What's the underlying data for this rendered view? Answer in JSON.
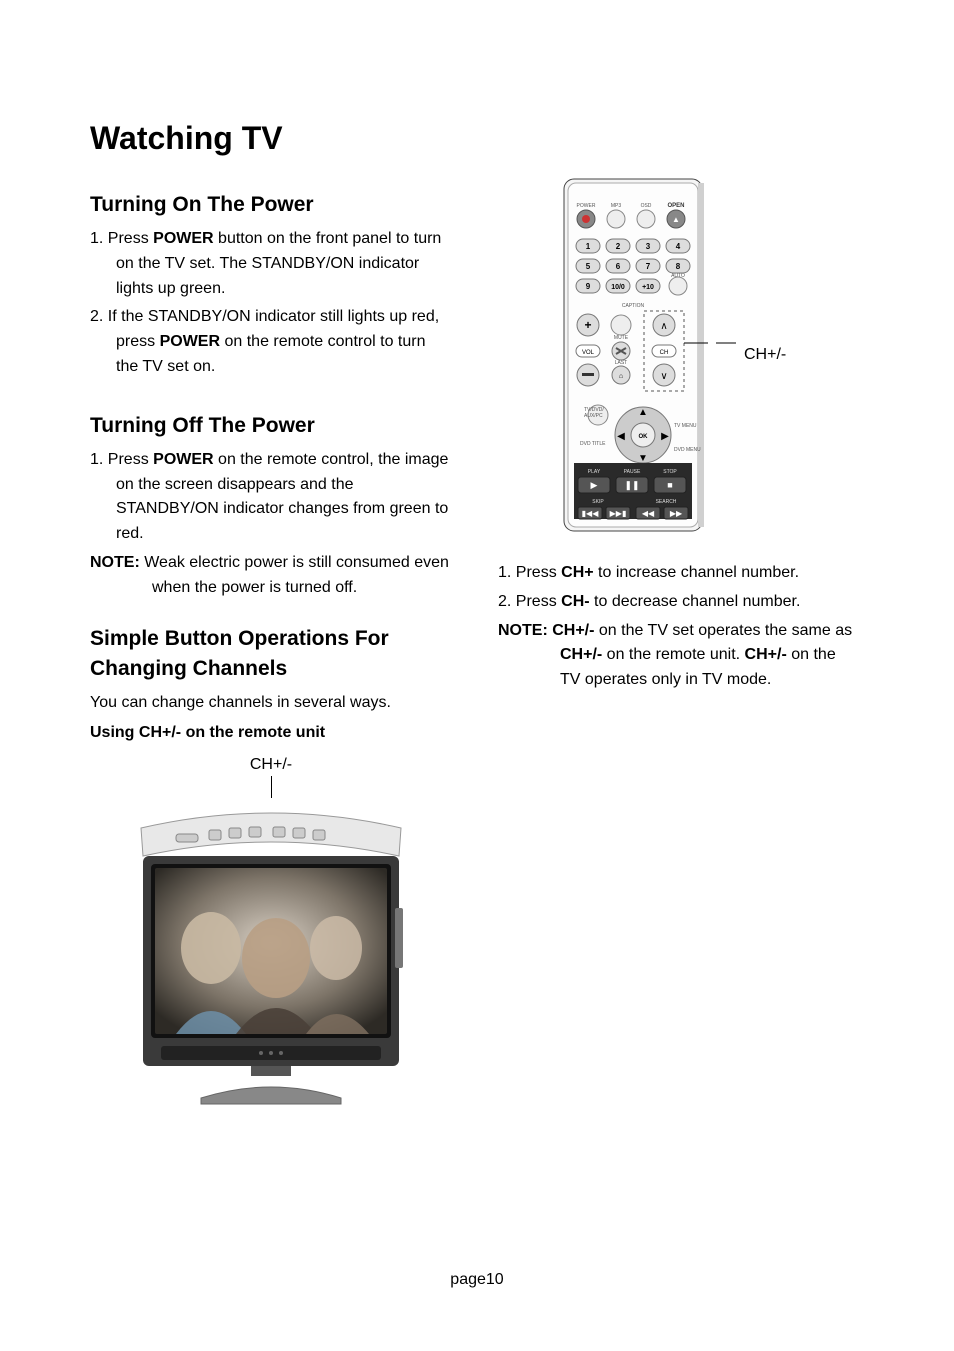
{
  "title": "Watching TV",
  "sections": {
    "turn_on": {
      "heading": "Turning On The Power",
      "item1_pre": "1. Press  ",
      "item1_bold": "POWER",
      "item1_post": "  button on the front panel to turn on the TV set. The STANDBY/ON indicator lights up green.",
      "item2_pre": "2. If the STANDBY/ON indicator still lights up red, press  ",
      "item2_bold": "POWER",
      "item2_post": "  on the remote control to turn the TV set on."
    },
    "turn_off": {
      "heading": "Turning Off The Power",
      "item1_pre": "1. Press  ",
      "item1_bold": "POWER",
      "item1_post": "  on the remote control, the image on the screen disappears and the STANDBY/ON indicator changes from green to red.",
      "note_label": "NOTE:",
      "note_text": " Weak electric power is still consumed even when the power is turned off."
    },
    "changing": {
      "heading_line1": "Simple Button Operations For",
      "heading_line2": "Changing Channels",
      "intro": "You can change channels in several ways.",
      "sub": "Using CH+/- on the remote unit",
      "tv_label": "CH+/-"
    },
    "right": {
      "remote_label": "CH+/-",
      "item1_pre": "1. Press  ",
      "item1_bold": "CH+",
      "item1_post": "  to increase channel number.",
      "item2_pre": "2. Press  ",
      "item2_bold": "CH-",
      "item2_post": "   to decrease channel number.",
      "note_label": "NOTE:  ",
      "note_b1": "CH+/-",
      "note_t1": "  on the TV set operates the same as  ",
      "note_b2": "CH+/-",
      "note_t2": "  on the remote unit. ",
      "note_b3": "CH+/-",
      "note_t3": "  on the TV operates only in TV mode."
    }
  },
  "page_number": "page10",
  "remote": {
    "top_row": [
      "POWER",
      "MP3",
      "OSD",
      "OPEN"
    ],
    "numbers": [
      "1",
      "2",
      "3",
      "4",
      "5",
      "6",
      "7",
      "8",
      "9",
      "10/0",
      "+10"
    ],
    "auto": "AUTO",
    "caption": "CAPTION",
    "mute": "MUTE",
    "last": "LAST",
    "vol": "VOL",
    "ch": "CH",
    "ok": "OK",
    "tv_dvd": "TV/DVD/\nAUX/PC",
    "dvd_title": "DVD TITLE",
    "tv_menu": "TV MENU",
    "dvd_menu": "DVD MENU",
    "play": "PLAY",
    "pause": "PAUSE",
    "stop": "STOP",
    "skip": "SKIP",
    "search": "SEARCH"
  }
}
